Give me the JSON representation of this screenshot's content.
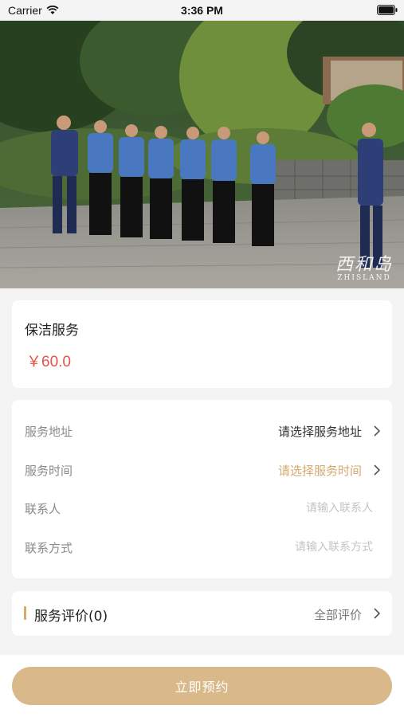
{
  "status_bar": {
    "carrier": "Carrier",
    "time": "3:36 PM"
  },
  "hero": {
    "description_icon": "team-photo",
    "watermark_main": "西和岛",
    "watermark_sub": "ZHISLAND"
  },
  "product": {
    "name": "保洁服务",
    "price": "￥60.0"
  },
  "form": {
    "address": {
      "label": "服务地址",
      "value": "请选择服务地址"
    },
    "time": {
      "label": "服务时间",
      "value": "请选择服务时间"
    },
    "contact": {
      "label": "联系人",
      "placeholder": "请输入联系人"
    },
    "phone": {
      "label": "联系方式",
      "placeholder": "请输入联系方式"
    }
  },
  "reviews": {
    "title": "服务评价(0)",
    "all_label": "全部评价"
  },
  "actions": {
    "book_label": "立即预约"
  },
  "colors": {
    "accent": "#d6a96c",
    "price": "#e8534a",
    "button": "#d9b989",
    "background": "#f4f4f4"
  }
}
